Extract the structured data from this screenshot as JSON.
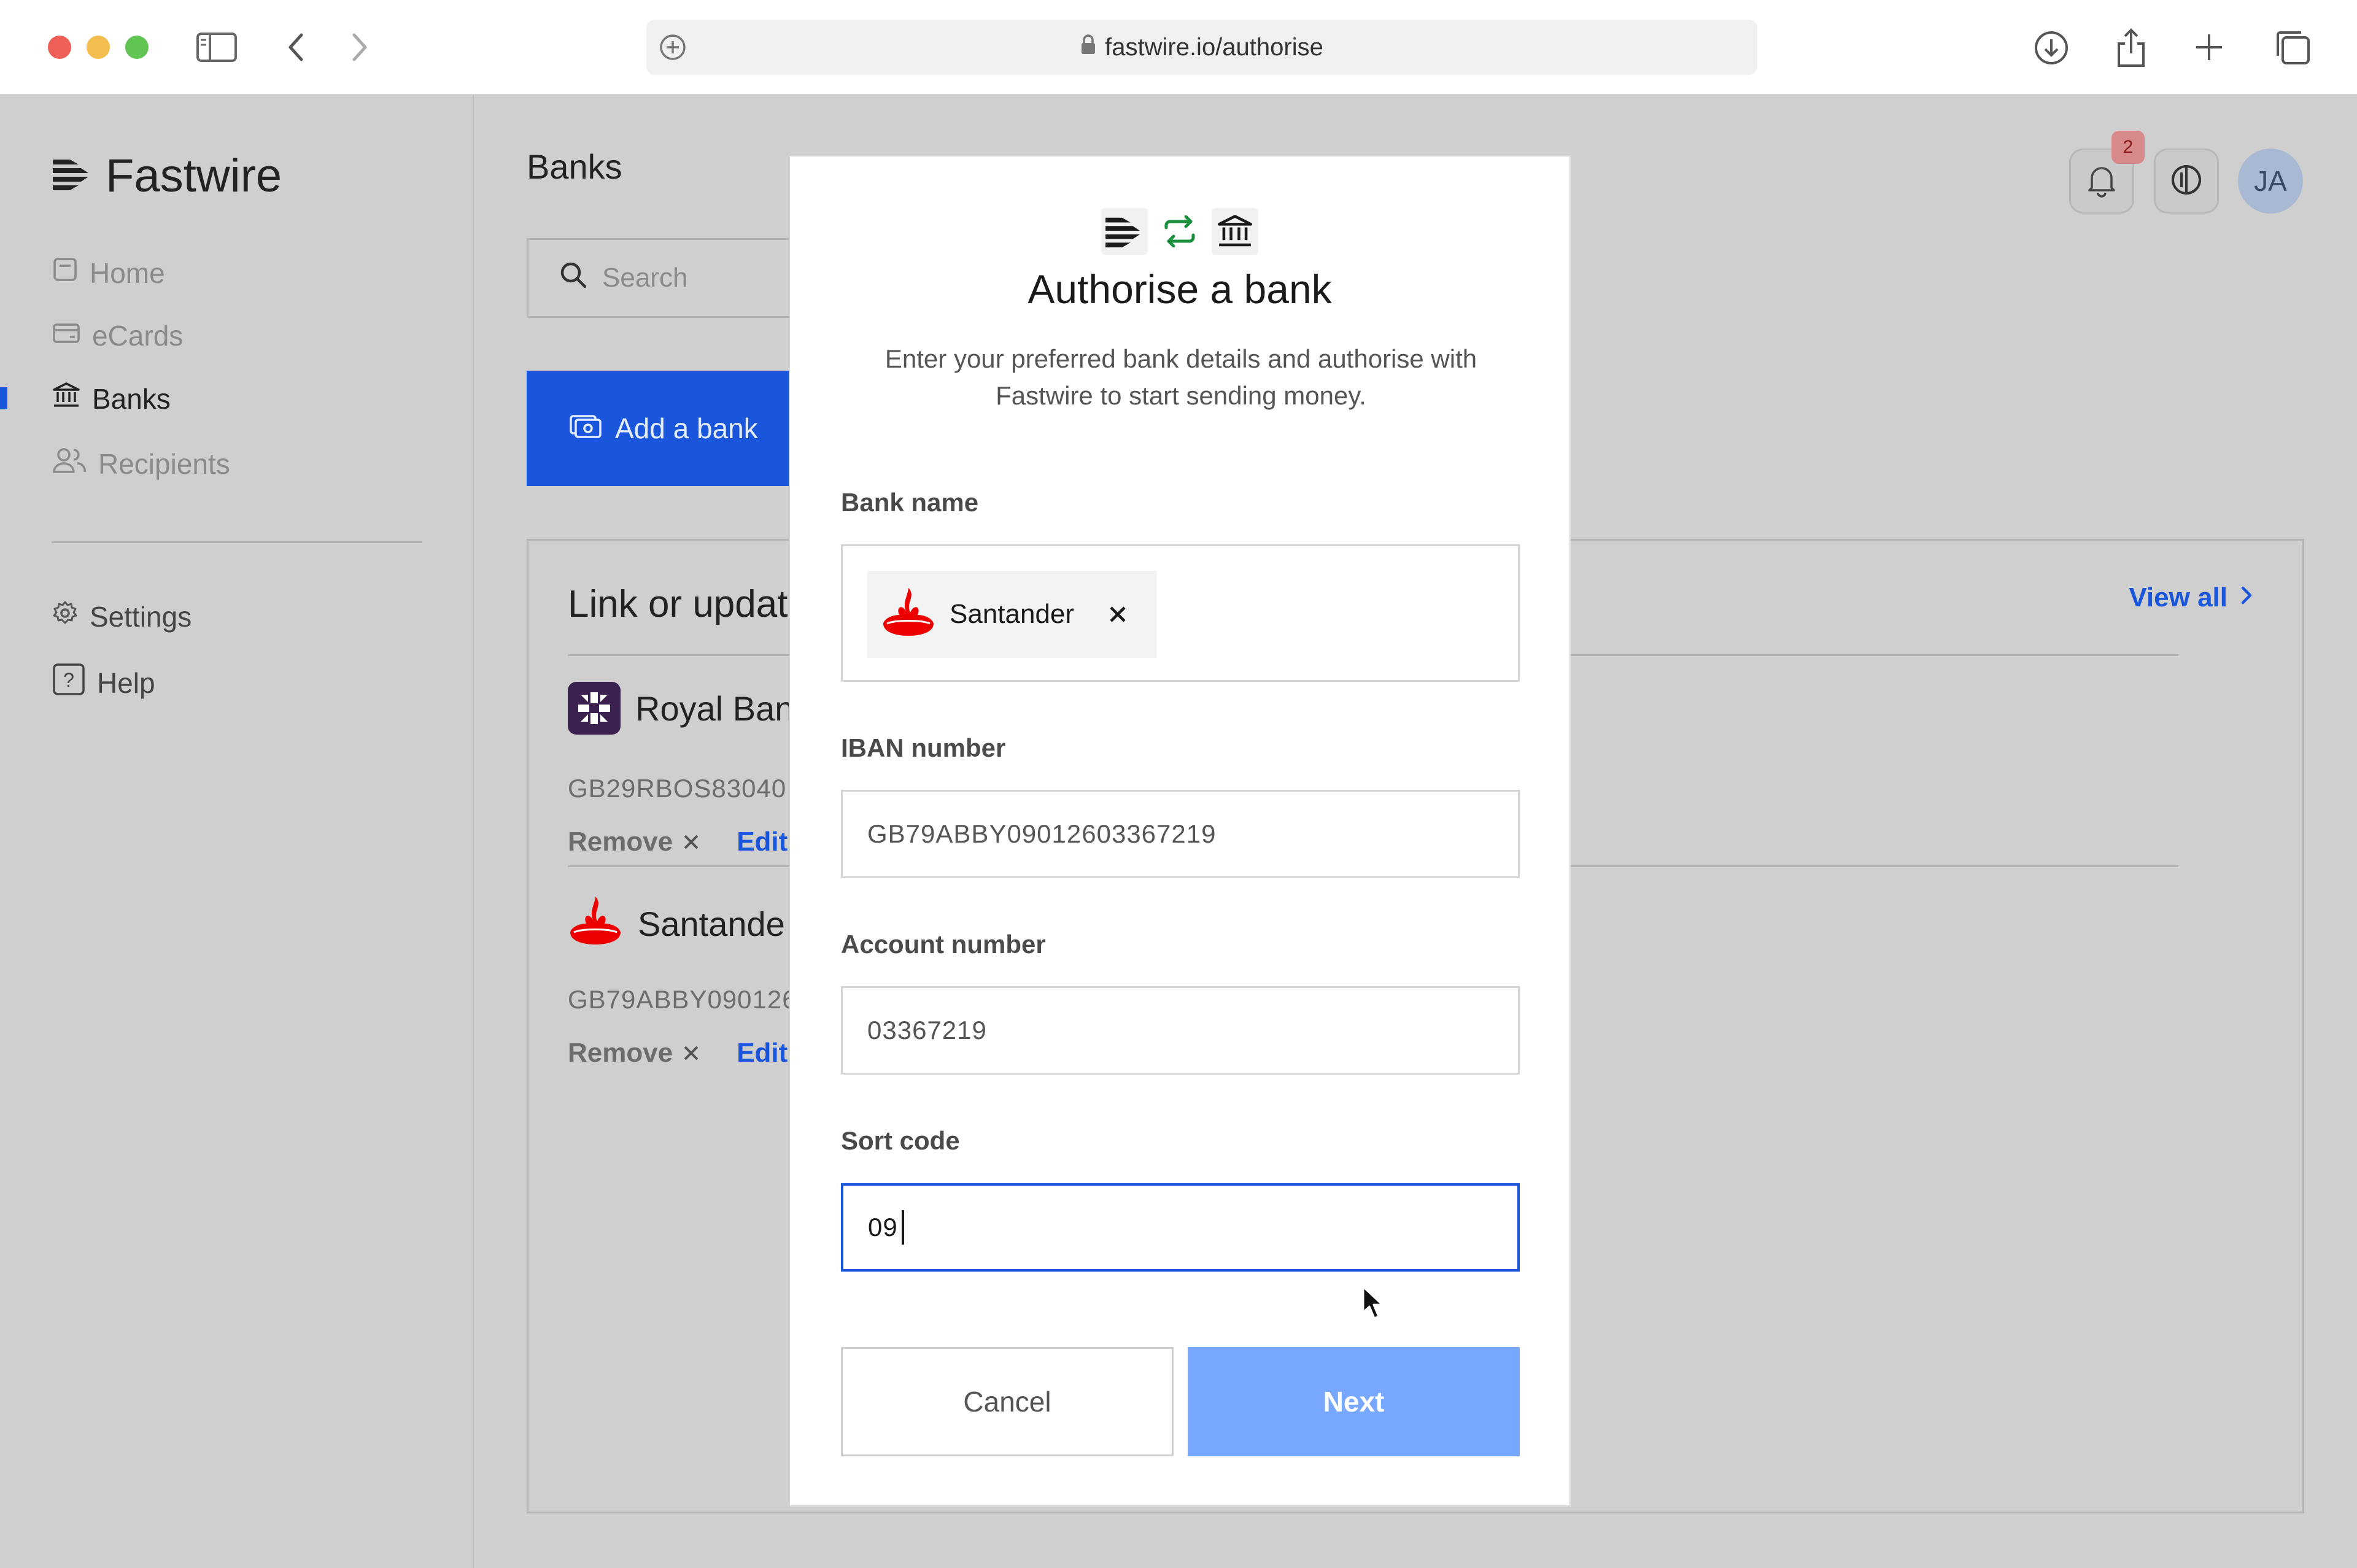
{
  "browser": {
    "url": "fastwire.io/authorise"
  },
  "sidebar": {
    "brand": "Fastwire",
    "items": [
      {
        "label": "Home",
        "icon": "home-icon"
      },
      {
        "label": "eCards",
        "icon": "card-icon"
      },
      {
        "label": "Banks",
        "icon": "bank-icon",
        "active": true
      },
      {
        "label": "Recipients",
        "icon": "users-icon"
      }
    ],
    "secondary": [
      {
        "label": "Settings",
        "icon": "gear-icon"
      },
      {
        "label": "Help",
        "icon": "help-icon"
      }
    ]
  },
  "header": {
    "title": "Banks",
    "notifications_count": "2",
    "avatar_initials": "JA"
  },
  "toolbar": {
    "search_placeholder": "Search",
    "add_bank_label": "Add a bank"
  },
  "linked_card": {
    "title": "Link or updat",
    "view_all_label": "View all",
    "banks": [
      {
        "name": "Royal Ban",
        "iban": "GB29RBOS83040",
        "remove_label": "Remove",
        "edit_label": "Edit"
      },
      {
        "name": "Santande",
        "iban": "GB79ABBY090126",
        "remove_label": "Remove",
        "edit_label": "Edit"
      }
    ]
  },
  "modal": {
    "title": "Authorise a bank",
    "subtitle_line1": "Enter your preferred bank details and authorise with",
    "subtitle_line2": "Fastwire to start sending money.",
    "bank_name_label": "Bank name",
    "bank_name_value": "Santander",
    "iban_label": "IBAN number",
    "iban_value": "GB79ABBY09012603367219",
    "account_label": "Account number",
    "account_value": "03367219",
    "sort_label": "Sort code",
    "sort_value": "09",
    "cancel_label": "Cancel",
    "next_label": "Next"
  },
  "colors": {
    "accent": "#1a56db",
    "next_button": "#77a7ff",
    "santander_red": "#ec0000",
    "transfer_green": "#1a8f3c"
  }
}
